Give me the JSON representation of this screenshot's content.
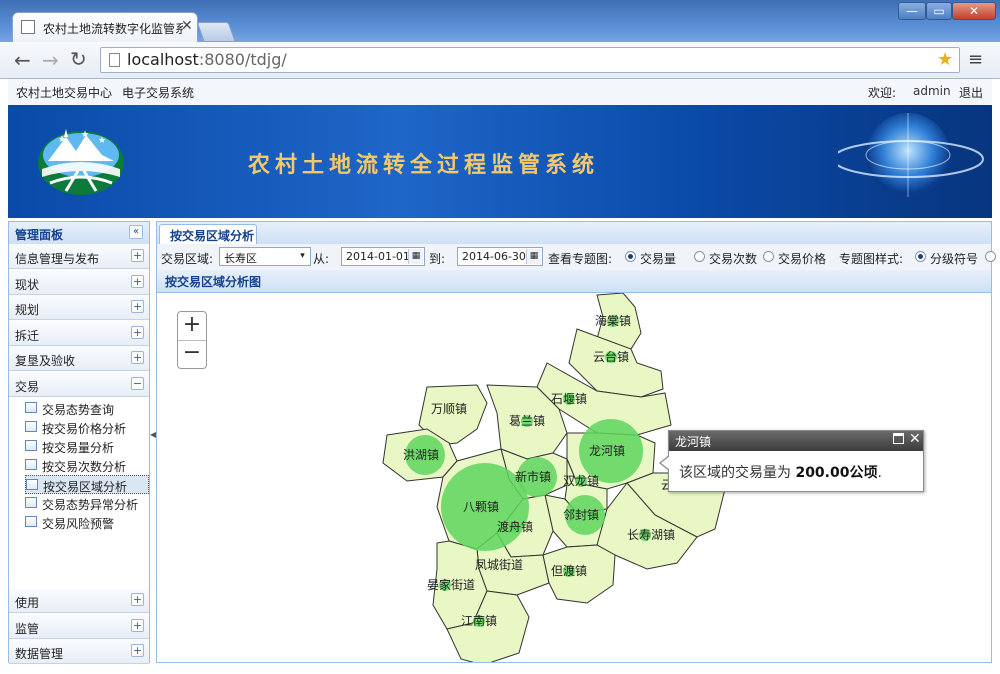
{
  "browser": {
    "tab_title": "农村土地流转数字化监管系统",
    "url_host": "localhost",
    "url_rest": ":8080/tdjg/"
  },
  "appbar": {
    "links": [
      "农村土地交易中心",
      "电子交易系统"
    ],
    "welcome_label": "欢迎:",
    "user": "admin",
    "logout": "退出"
  },
  "banner": {
    "title": "农村土地流转全过程监管系统"
  },
  "side": {
    "title": "管理面板",
    "sections_top": [
      "信息管理与发布",
      "现状",
      "规划",
      "拆迁",
      "复垦及验收"
    ],
    "open_section": "交易",
    "tree": [
      "交易态势查询",
      "按交易价格分析",
      "按交易量分析",
      "按交易次数分析",
      "按交易区域分析",
      "交易态势异常分析",
      "交易风险预警"
    ],
    "selected_index": 4,
    "sections_bottom": [
      "使用",
      "监管",
      "数据管理"
    ]
  },
  "main": {
    "tab": "按交易区域分析",
    "filters": {
      "area_label": "交易区域:",
      "area_value": "长寿区",
      "from_label": "从:",
      "from_value": "2014-01-01",
      "to_label": "到:",
      "to_value": "2014-06-30",
      "topic_label": "查看专题图:",
      "topics": [
        "交易量",
        "交易次数",
        "交易价格"
      ],
      "topic_selected": 0,
      "style_label": "专题图样式:",
      "styles": [
        "分级符号"
      ],
      "style_selected": 0
    },
    "panel_title": "按交易区域分析图"
  },
  "map": {
    "fill_color": "#e8f7c4",
    "border_color": "#333333",
    "symbol_color": "#5ed65e",
    "towns": [
      {
        "name": "海棠镇",
        "symbol": "small"
      },
      {
        "name": "云台镇",
        "symbol": "small"
      },
      {
        "name": "石堰镇",
        "symbol": "small"
      },
      {
        "name": "万顺镇",
        "symbol": "none"
      },
      {
        "name": "葛兰镇",
        "symbol": "small"
      },
      {
        "name": "洪湖镇",
        "symbol": "medium"
      },
      {
        "name": "龙河镇",
        "symbol": "large"
      },
      {
        "name": "新市镇",
        "symbol": "medium"
      },
      {
        "name": "双龙镇",
        "symbol": "small"
      },
      {
        "name": "八颗镇",
        "symbol": "xlarge"
      },
      {
        "name": "云集镇",
        "symbol": "small"
      },
      {
        "name": "邻封镇",
        "symbol": "medium"
      },
      {
        "name": "渡舟镇",
        "symbol": "small"
      },
      {
        "name": "长寿湖镇",
        "symbol": "small"
      },
      {
        "name": "凤城街道",
        "symbol": "none"
      },
      {
        "name": "但渡镇",
        "symbol": "small"
      },
      {
        "name": "晏家街道",
        "symbol": "small"
      },
      {
        "name": "江南镇",
        "symbol": "small"
      }
    ]
  },
  "popup": {
    "title": "龙河镇",
    "text_before": "该区域的交易量为 ",
    "value": "200.00",
    "unit": "公顷",
    "text_after": "."
  },
  "icons": {
    "zoom_in": "+",
    "zoom_out": "−",
    "expand": "+",
    "collapse": "−",
    "panel_collapse": "«",
    "close": "✕"
  }
}
